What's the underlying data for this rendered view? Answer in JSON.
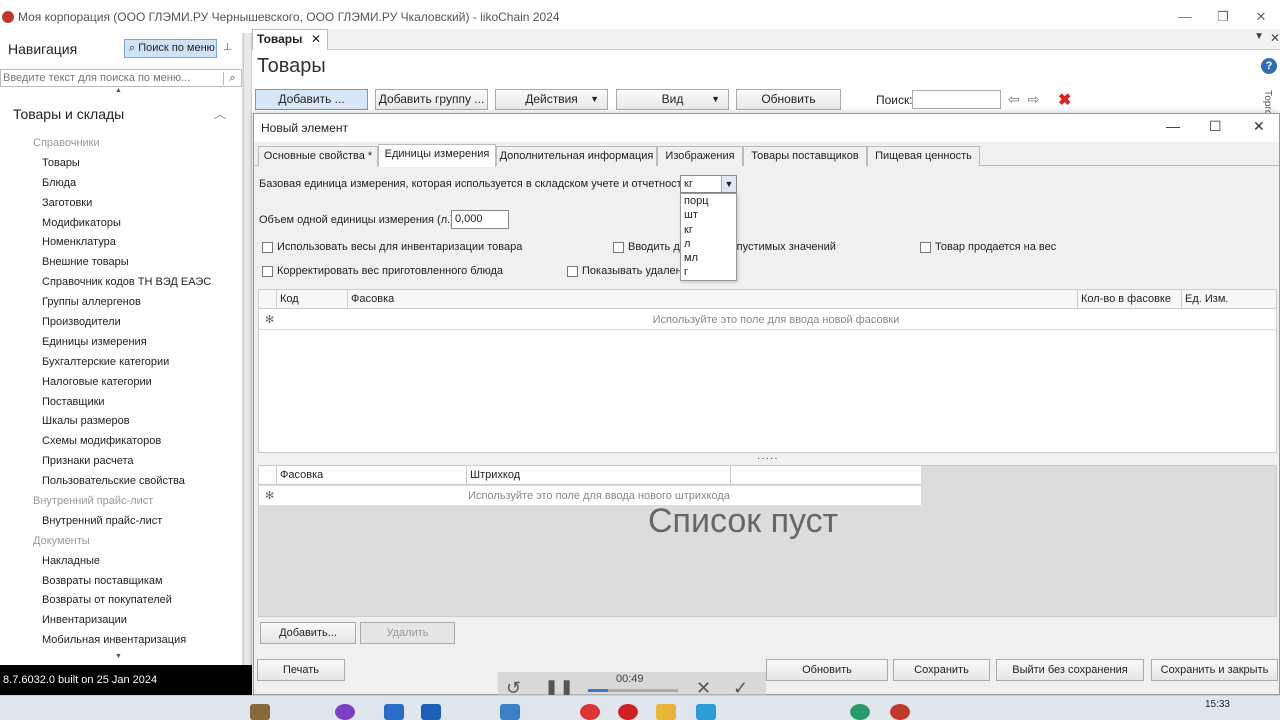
{
  "window": {
    "title": "Моя корпорация (ООО ГЛЭМИ.РУ Чернышевского, ООО ГЛЭМИ.РУ Чкаловский) - iikoChain 2024",
    "minimize": "—",
    "restore": "❐",
    "close": "✕"
  },
  "navigation": {
    "title": "Навигация",
    "search_button": "Поиск по меню",
    "pin": "⊥",
    "search_placeholder": "Введите текст для поиска по меню...",
    "search_icon": "⌕",
    "section": "Товары и склады",
    "section_chevron": "︿",
    "scroll_up": "▲",
    "scroll_down": "▼",
    "items": [
      {
        "label": "Справочники",
        "group": true
      },
      {
        "label": "Товары"
      },
      {
        "label": "Блюда"
      },
      {
        "label": "Заготовки"
      },
      {
        "label": "Модификаторы"
      },
      {
        "label": "Номенклатура"
      },
      {
        "label": "Внешние товары"
      },
      {
        "label": "Справочник кодов ТН ВЭД ЕАЭС"
      },
      {
        "label": "Группы аллергенов"
      },
      {
        "label": "Производители"
      },
      {
        "label": "Единицы измерения"
      },
      {
        "label": "Бухгалтерские категории"
      },
      {
        "label": "Налоговые категории"
      },
      {
        "label": "Поставщики"
      },
      {
        "label": "Шкалы размеров"
      },
      {
        "label": "Схемы модификаторов"
      },
      {
        "label": "Признаки расчета"
      },
      {
        "label": "Пользовательские свойства"
      },
      {
        "label": "Внутренний прайс-лист",
        "group": true
      },
      {
        "label": "Внутренний прайс-лист"
      },
      {
        "label": "Документы",
        "group": true
      },
      {
        "label": "Накладные"
      },
      {
        "label": "Возвраты поставщикам"
      },
      {
        "label": "Возвраты от покупателей"
      },
      {
        "label": "Инвентаризации"
      },
      {
        "label": "Мобильная инвентаризация"
      }
    ]
  },
  "status": {
    "build": "8.7.6032.0 built on 25 Jan 2024"
  },
  "main": {
    "tab_label": "Товары",
    "tab_close": "✕",
    "tab_dropdown": "▼",
    "tab_strip_close": "✕",
    "page_title": "Товары",
    "help": "?",
    "side_label": "Торго",
    "toolbar": {
      "add": "Добавить ...",
      "add_group": "Добавить группу ...",
      "actions": "Действия",
      "view": "Вид",
      "refresh": "Обновить",
      "dropdown_arrow": "▼",
      "search_label": "Поиск:",
      "nav_arrows": "⇦⇨",
      "clear": "✖"
    }
  },
  "dialog": {
    "title": "Новый элемент",
    "minimize": "—",
    "maximize": "☐",
    "close": "✕",
    "tabs": [
      "Основные свойства *",
      "Единицы измерения",
      "Дополнительная информация",
      "Изображения",
      "Товары поставщиков",
      "Пищевая ценность"
    ],
    "base_unit_label": "Базовая единица измерения, которая используется в складском учете и отчетности:",
    "base_unit_value": "кг",
    "combo_arrow": "▼",
    "unit_options": [
      "порц",
      "шт",
      "кг",
      "л",
      "мл",
      "г"
    ],
    "volume_label": "Объем одной единицы измерения (л.).",
    "volume_value": "0,000",
    "checkboxes": {
      "use_scales": "Использовать весы для инвентаризации товара",
      "enter_range": "Вводить диапазон допустимых значений",
      "sold_by_weight": "Товар продается на вес",
      "adjust_weight": "Корректировать вес приготовленного блюда",
      "show_deleted": "Показывать удаленные"
    },
    "packaging_grid": {
      "columns": [
        "Код",
        "Фасовка",
        "Кол-во в фасовке",
        "Ед. Изм."
      ],
      "new_row_hint": "Используйте это поле для ввода новой фасовки",
      "row_marker": "✻"
    },
    "splitter": "·····",
    "barcode_grid": {
      "columns": [
        "Фасовка",
        "Штрихкод"
      ],
      "new_row_hint": "Используйте это поле для ввода нового штрихкода",
      "row_marker": "✻",
      "empty_message": "Список пуст"
    },
    "buttons": {
      "add": "Добавить...",
      "delete": "Удалить",
      "print": "Печать",
      "refresh": "Обновить",
      "save": "Сохранить",
      "exit_no_save": "Выйти без сохранения",
      "save_close": "Сохранить и закрыть"
    }
  },
  "video": {
    "time": "00:49",
    "progress": 0.22,
    "rewind": "↺",
    "pause": "❚❚",
    "cancel": "✕",
    "confirm": "✓"
  },
  "taskbar": {
    "clock": "15:33"
  }
}
